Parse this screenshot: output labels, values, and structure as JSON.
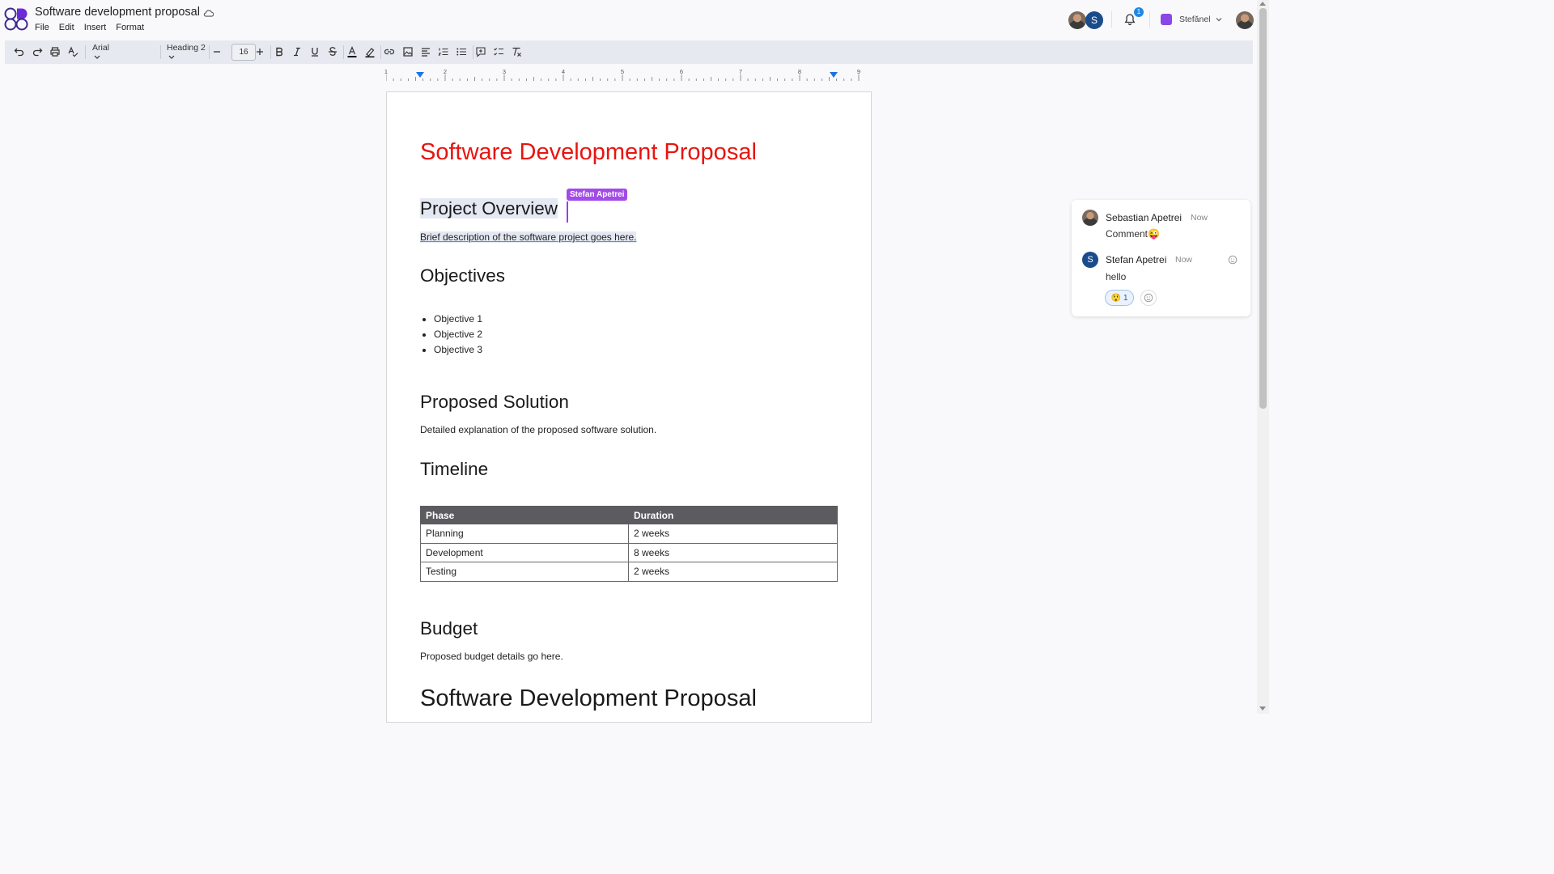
{
  "header": {
    "doc_title": "Software development proposal",
    "menu": [
      "File",
      "Edit",
      "Insert",
      "Format"
    ],
    "notification_count": "1",
    "workspace": "Stefănel",
    "collaborator_initial": "S"
  },
  "toolbar": {
    "font": "Arial",
    "style": "Heading 2",
    "font_size": "16"
  },
  "ruler": {
    "labels": [
      "1",
      "2",
      "3",
      "4",
      "5",
      "6",
      "7",
      "8",
      "9"
    ]
  },
  "document": {
    "title": "Software Development Proposal",
    "collaborator_cursor": "Stefan Apetrei",
    "sections": {
      "overview_heading": "Project Overview",
      "overview_text": "Brief description of the software project goes here.",
      "objectives_heading": "Objectives",
      "objectives": [
        "Objective 1",
        "Objective 2",
        "Objective 3"
      ],
      "solution_heading": "Proposed Solution",
      "solution_text": "Detailed explanation of the proposed software solution.",
      "timeline_heading": "Timeline",
      "budget_heading": "Budget",
      "budget_text": "Proposed budget details go here.",
      "repeat_title": "Software Development Proposal"
    },
    "timeline_table": {
      "headers": [
        "Phase",
        "Duration"
      ],
      "rows": [
        [
          "Planning",
          "2 weeks"
        ],
        [
          "Development",
          "8 weeks"
        ],
        [
          "Testing",
          "2 weeks"
        ]
      ]
    },
    "title_color": "#e8140f"
  },
  "comments": [
    {
      "author": "Sebastian Apetrei",
      "time": "Now",
      "text": "Comment😜"
    },
    {
      "author": "Stefan Apetrei",
      "time": "Now",
      "text": "hello",
      "initial": "S",
      "reaction": "😲",
      "reaction_count": "1"
    }
  ]
}
